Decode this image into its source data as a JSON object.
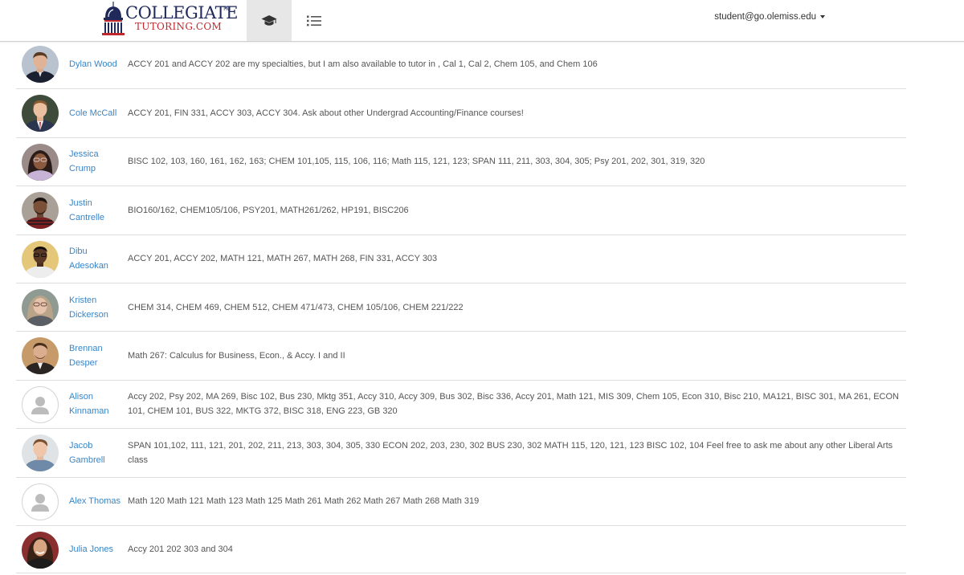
{
  "brand": {
    "name_top": "COLLEGIATE",
    "trademark": "TM",
    "name_bottom": "TUTORING.COM",
    "navy": "#1f2a5a",
    "red": "#c0282d"
  },
  "nav": {
    "tabs": [
      {
        "icon": "graduation-cap-icon",
        "active": true
      },
      {
        "icon": "list-icon",
        "active": false
      }
    ],
    "user_email": "student@go.olemiss.edu"
  },
  "link_color": "#3a85c6",
  "tutors": [
    {
      "name": "Dylan Wood",
      "subjects": "ACCY 201 and ACCY 202 are my specialties, but I am also available to tutor in , Cal 1, Cal 2, Chem 105, and Chem 106",
      "avatar": "photo"
    },
    {
      "name": "Cole McCall",
      "subjects": "ACCY 201, FIN 331, ACCY 303, ACCY 304. Ask about other Undergrad Accounting/Finance courses!",
      "avatar": "photo"
    },
    {
      "name": "Jessica Crump",
      "subjects": "BISC 102, 103, 160, 161, 162, 163; CHEM 101,105, 115, 106, 116; Math 115, 121, 123; SPAN 111, 211, 303, 304, 305; Psy 201, 202, 301, 319, 320",
      "avatar": "photo"
    },
    {
      "name": "Justin Cantrelle",
      "subjects": "BIO160/162, CHEM105/106, PSY201, MATH261/262, HP191, BISC206",
      "avatar": "photo"
    },
    {
      "name": "Dibu Adesokan",
      "subjects": "ACCY 201, ACCY 202, MATH 121, MATH 267, MATH 268, FIN 331, ACCY 303",
      "avatar": "photo"
    },
    {
      "name": "Kristen Dickerson",
      "subjects": "CHEM 314, CHEM 469, CHEM 512, CHEM 471/473, CHEM 105/106, CHEM 221/222",
      "avatar": "photo"
    },
    {
      "name": "Brennan Desper",
      "subjects": "Math 267: Calculus for Business, Econ., & Accy. I and II",
      "avatar": "photo"
    },
    {
      "name": "Alison Kinnaman",
      "subjects": "Accy 202, Psy 202, MA 269, Bisc 102, Bus 230, Mktg 351, Accy 310, Accy 309, Bus 302, Bisc 336, Accy 201, Math 121, MIS 309, Chem 105, Econ 310, Bisc 210, MA121, BISC 301, MA 261, ECON 101, CHEM 101, BUS 322, MKTG 372, BISC 318, ENG 223, GB 320",
      "avatar": "placeholder"
    },
    {
      "name": "Jacob Gambrell",
      "subjects": "SPAN 101,102, 111, 121, 201, 202, 211, 213, 303, 304, 305, 330 ECON 202, 203, 230, 302 BUS 230, 302 MATH 115, 120, 121, 123 BISC 102, 104 Feel free to ask me about any other Liberal Arts class",
      "avatar": "photo"
    },
    {
      "name": "Alex Thomas",
      "subjects": "Math 120 Math 121 Math 123 Math 125 Math 261 Math 262 Math 267 Math 268 Math 319",
      "avatar": "placeholder"
    },
    {
      "name": "Julia Jones",
      "subjects": "Accy 201 202 303 and 304",
      "avatar": "photo"
    }
  ]
}
